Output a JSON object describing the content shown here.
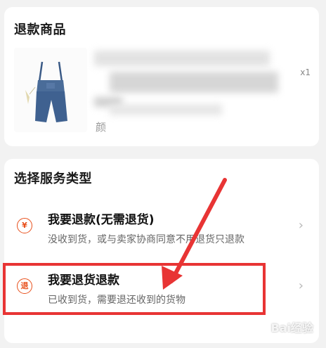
{
  "product_card": {
    "title": "退款商品",
    "spec_partial": "颜",
    "qty": "x1"
  },
  "service_card": {
    "title": "选择服务类型",
    "options": [
      {
        "title": "我要退款(无需退货)",
        "subtitle": "没收到货，或与卖家协商同意不用退货只退款",
        "icon_char": "¥",
        "icon": "refund-yuan-icon"
      },
      {
        "title": "我要退货退款",
        "subtitle": "已收到货，需要退还收到的货物",
        "icon_char": "退",
        "icon": "return-goods-icon"
      }
    ]
  },
  "annotation": {
    "highlight_color": "#e83434",
    "arrow_color": "#e83434"
  },
  "accent_color": "#e8501c",
  "watermark": "Bai经验"
}
